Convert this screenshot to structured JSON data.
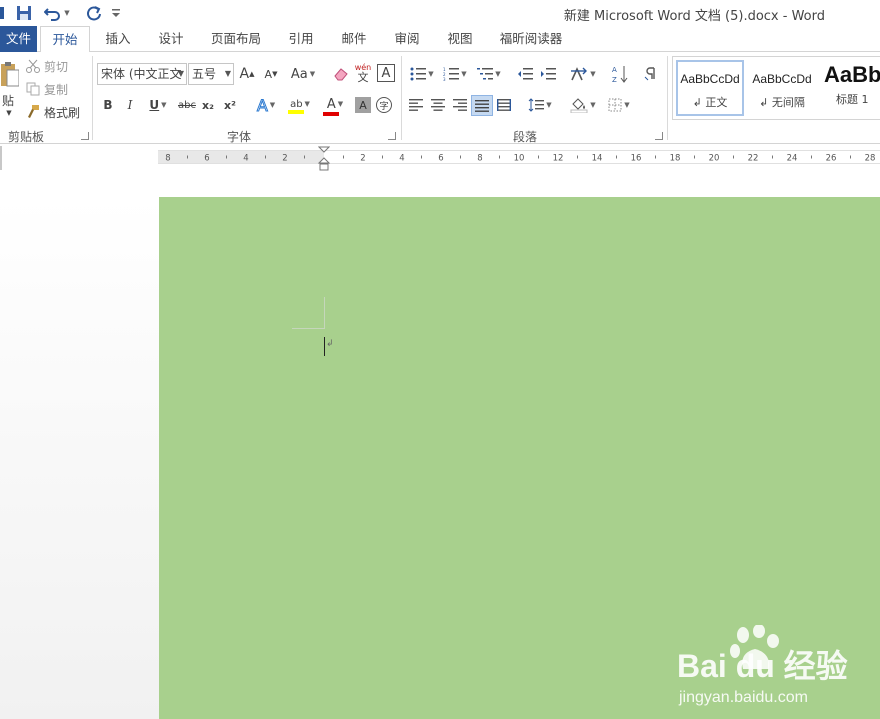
{
  "window": {
    "title": "新建 Microsoft Word 文档 (5).docx - Word"
  },
  "tabs": [
    {
      "label": "文件"
    },
    {
      "label": "开始"
    },
    {
      "label": "插入"
    },
    {
      "label": "设计"
    },
    {
      "label": "页面布局"
    },
    {
      "label": "引用"
    },
    {
      "label": "邮件"
    },
    {
      "label": "审阅"
    },
    {
      "label": "视图"
    },
    {
      "label": "福昕阅读器"
    }
  ],
  "clipboard": {
    "paste_label": "贴",
    "cut_label": "剪切",
    "copy_label": "复制",
    "format_painter_label": "格式刷",
    "group_label": "剪贴板"
  },
  "font": {
    "font_name": "宋体 (中文正文",
    "font_size": "五号",
    "group_label": "字体",
    "phonetic_label": "wén",
    "encircle_label": "字",
    "change_case_label": "Aa",
    "grow_label": "A",
    "shrink_label": "A",
    "bold_label": "B",
    "italic_label": "I",
    "underline_label": "U",
    "strike_label": "abc",
    "subscript_label": "x₂",
    "superscript_label": "x²",
    "font_color_label": "A",
    "shading_label": "A",
    "highlight_label": "ab"
  },
  "paragraph": {
    "group_label": "段落"
  },
  "styles": [
    {
      "preview": "AaBbCcDd",
      "name": "↲ 正文"
    },
    {
      "preview": "AaBbCcDd",
      "name": "↲ 无间隔"
    },
    {
      "preview": "AaBb",
      "name": "标题 1"
    }
  ],
  "ruler": {
    "left_numbers": [
      "8",
      "6",
      "4",
      "2"
    ],
    "right_numbers": [
      "2",
      "4",
      "6",
      "8",
      "10",
      "12",
      "14",
      "16",
      "18",
      "20",
      "22",
      "24",
      "26",
      "28"
    ]
  },
  "document": {
    "page_color": "#a8d08d",
    "paragraph_mark": "↲"
  },
  "watermark": {
    "brand": "Bai du 经验",
    "url": "jingyan.baidu.com"
  },
  "colors": {
    "accent": "#2b579a",
    "font_color_bar": "#e00000",
    "highlight_bar": "#ffff00"
  }
}
